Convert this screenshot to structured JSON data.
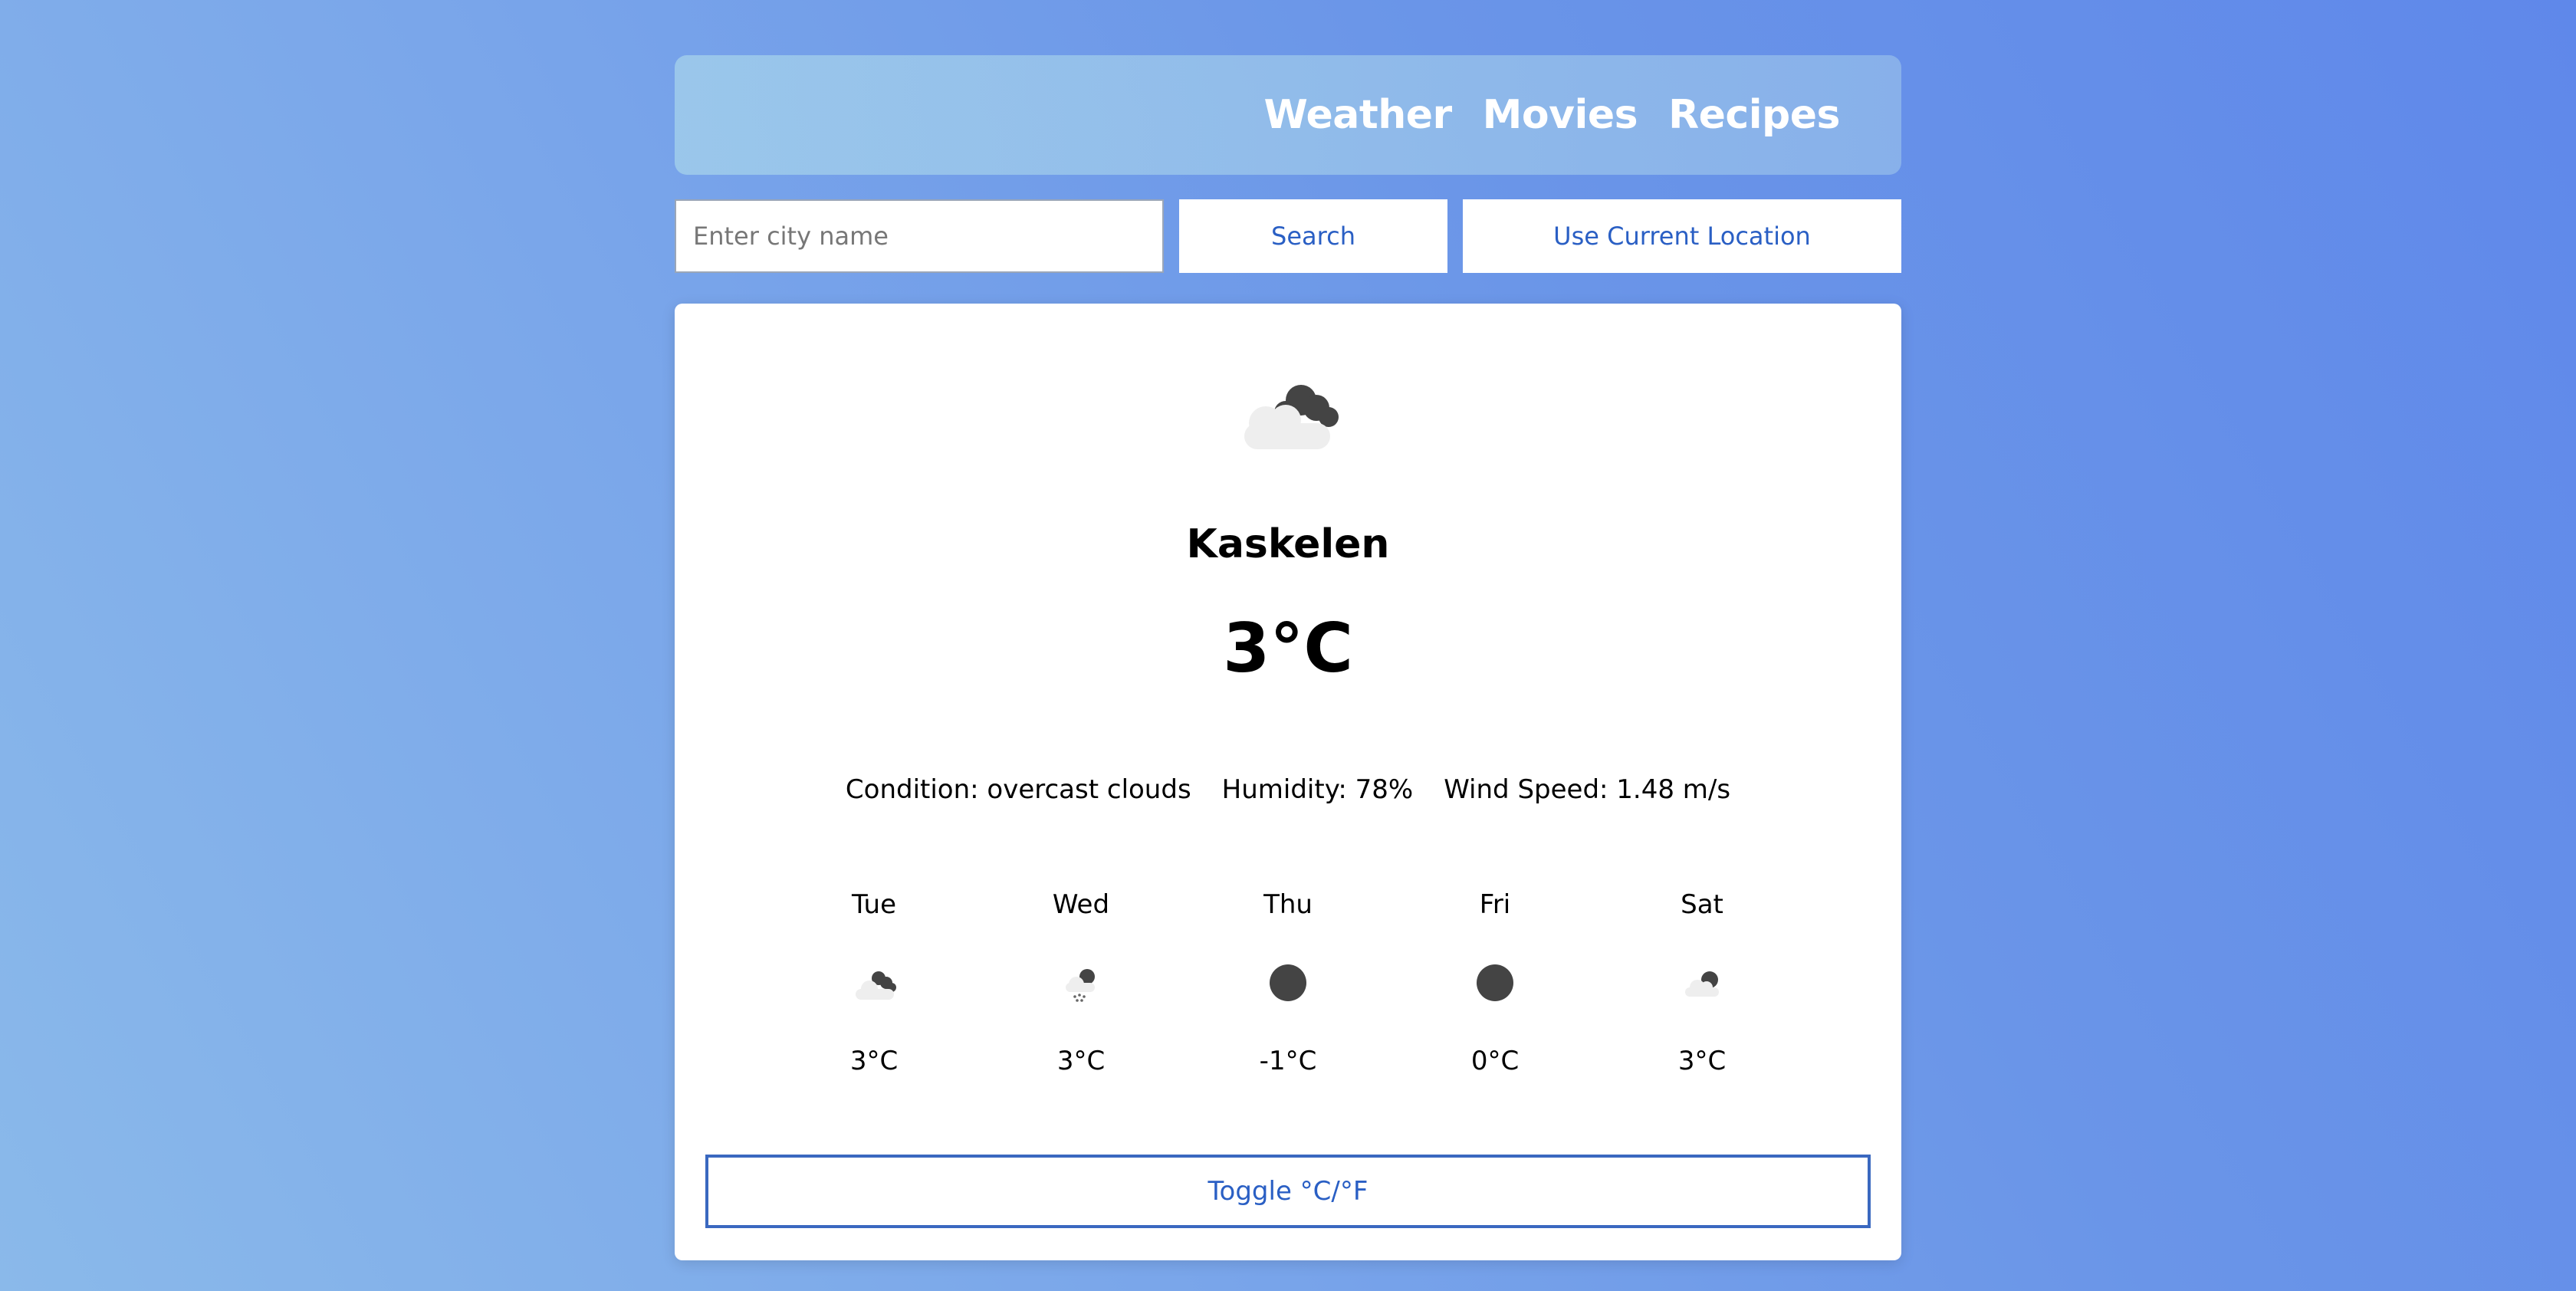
{
  "nav": {
    "links": [
      "Weather",
      "Movies",
      "Recipes"
    ]
  },
  "search": {
    "placeholder": "Enter city name",
    "value": "",
    "search_label": "Search",
    "location_label": "Use Current Location"
  },
  "current": {
    "icon": "overcast-clouds-icon",
    "city": "Kaskelen",
    "temperature": "3°C",
    "condition": "Condition: overcast clouds",
    "humidity": "Humidity: 78%",
    "wind": "Wind Speed: 1.48 m/s"
  },
  "forecast": [
    {
      "day": "Tue",
      "icon": "overcast-clouds-icon",
      "temp": "3°C"
    },
    {
      "day": "Wed",
      "icon": "snow-cloud-icon",
      "temp": "3°C"
    },
    {
      "day": "Thu",
      "icon": "dark-circle-icon",
      "temp": "-1°C"
    },
    {
      "day": "Fri",
      "icon": "dark-circle-icon",
      "temp": "0°C"
    },
    {
      "day": "Sat",
      "icon": "broken-clouds-icon",
      "temp": "3°C"
    }
  ],
  "toggle_label": "Toggle °C/°F",
  "colors": {
    "accent": "#2a5fc4",
    "icon_dark": "#444444",
    "icon_light": "#eeeeee"
  }
}
